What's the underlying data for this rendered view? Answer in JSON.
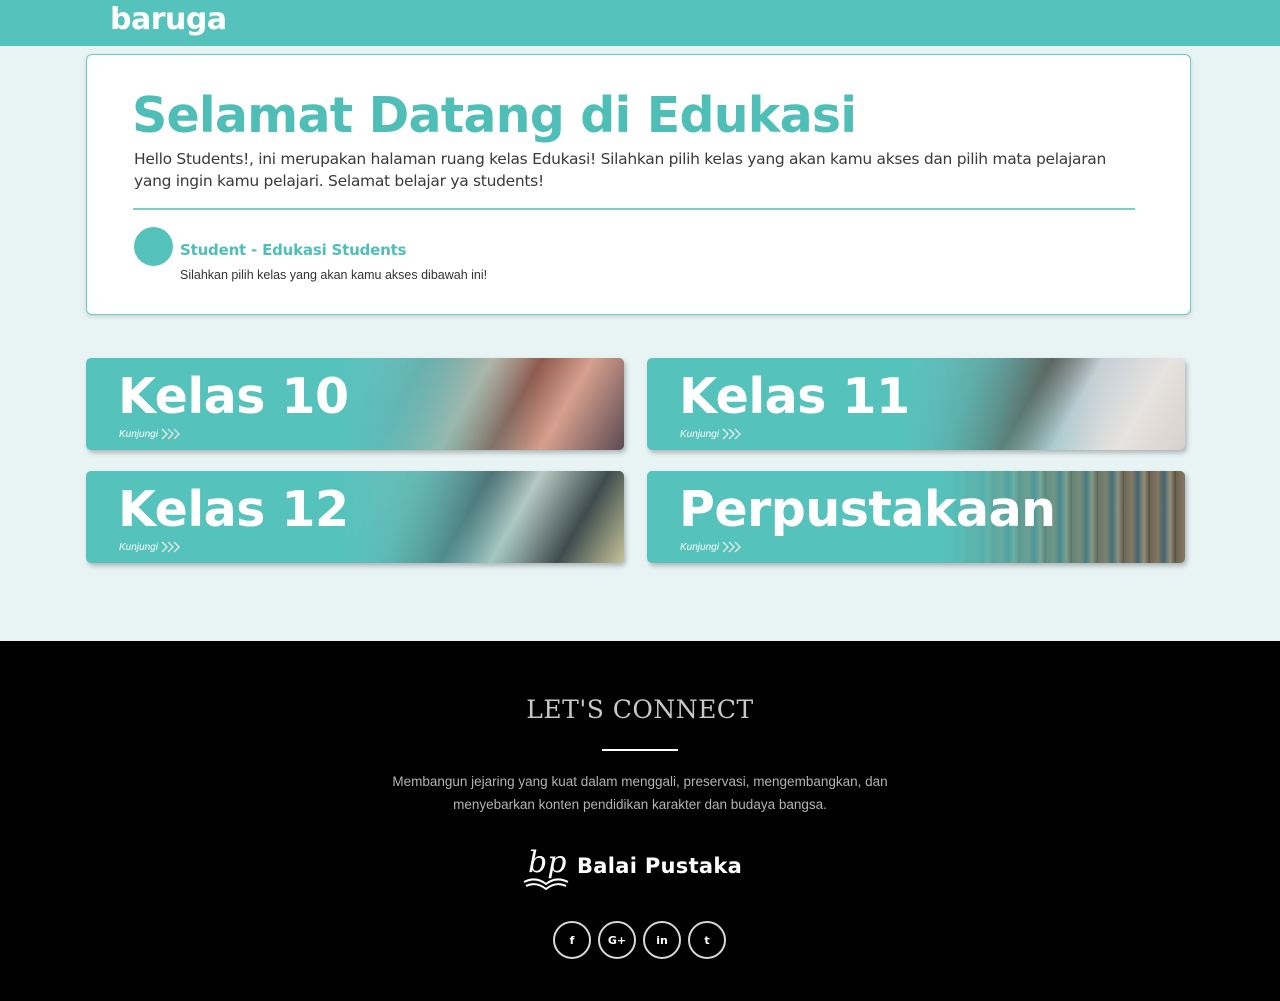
{
  "header": {
    "logo": "baruga",
    "bg_color": "#56c2bc"
  },
  "welcome": {
    "title": "Selamat Datang di Edukasi",
    "intro": "Hello Students!, ini merupakan halaman ruang kelas Edukasi! Silahkan pilih kelas yang akan kamu akses dan pilih mata pelajaran yang ingin kamu pelajari. Selamat belajar ya students!",
    "user_name": "Student - Edukasi Students",
    "user_subtitle": "Silahkan pilih kelas yang akan kamu akses dibawah ini!"
  },
  "cards": [
    {
      "title": "Kelas 10",
      "link": "Kunjungi"
    },
    {
      "title": "Kelas 11",
      "link": "Kunjungi"
    },
    {
      "title": "Kelas 12",
      "link": "Kunjungi"
    },
    {
      "title": "Perpustakaan",
      "link": "Kunjungi"
    }
  ],
  "footer": {
    "heading": "LET'S CONNECT",
    "tagline": "Membangun jejaring yang kuat dalam menggali, preservasi, mengembangkan, dan menyebarkan konten pendidikan karakter dan budaya bangsa.",
    "brand_mark": "bp",
    "brand_name": "Balai Pustaka",
    "socials": [
      {
        "icon": "facebook-icon",
        "glyph": "f"
      },
      {
        "icon": "google-plus-icon",
        "glyph": "G+"
      },
      {
        "icon": "linkedin-icon",
        "glyph": "in"
      },
      {
        "icon": "twitter-icon",
        "glyph": "t"
      }
    ]
  },
  "colors": {
    "accent": "#56c2bc",
    "title_text": "#4fbeb7",
    "page_bg": "#e8f4f4",
    "footer_bg": "#000000"
  }
}
